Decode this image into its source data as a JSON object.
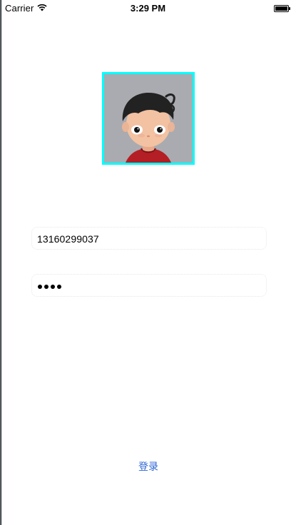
{
  "status_bar": {
    "carrier": "Carrier",
    "time": "3:29 PM",
    "wifi_icon": "wifi-icon",
    "battery_icon": "battery-icon"
  },
  "avatar": {
    "icon": "cartoon-boy-avatar",
    "border_color": "#00ffff"
  },
  "form": {
    "phone_value": "13160299037",
    "password_mask": "••••",
    "password_length": 4
  },
  "login_button": {
    "label": "登录",
    "color": "#2d66d6"
  }
}
